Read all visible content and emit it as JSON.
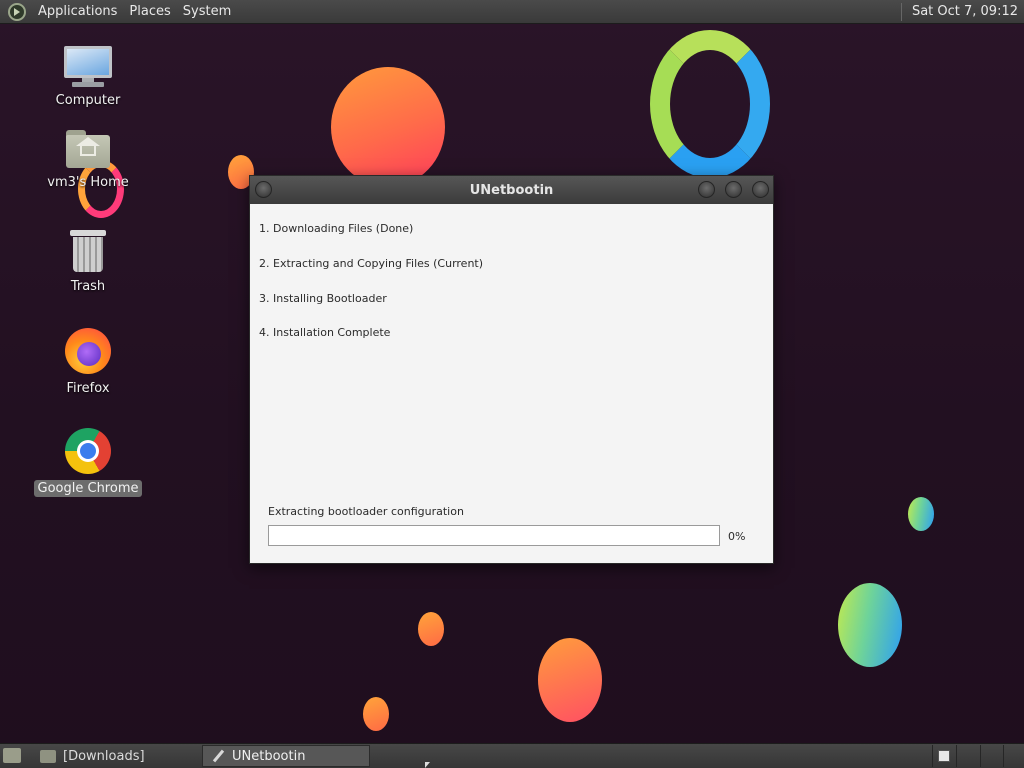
{
  "top_panel": {
    "menus": [
      "Applications",
      "Places",
      "System"
    ],
    "clock": "Sat Oct  7, 09:12"
  },
  "desktop": {
    "icons": [
      {
        "label": "Computer",
        "icon": "computer-icon"
      },
      {
        "label": "vm3's Home",
        "icon": "home-folder-icon"
      },
      {
        "label": "Trash",
        "icon": "trash-icon"
      },
      {
        "label": "Firefox",
        "icon": "firefox-icon"
      },
      {
        "label": "Google Chrome",
        "icon": "chrome-icon",
        "selected": true
      }
    ]
  },
  "window": {
    "title": "UNetbootin",
    "steps": [
      "1. Downloading Files (Done)",
      "2. Extracting and Copying Files (Current)",
      "3. Installing Bootloader",
      "4. Installation Complete"
    ],
    "status": "Extracting bootloader configuration",
    "progress": 0,
    "progress_label": "0%"
  },
  "taskbar": {
    "tasks": [
      "[Downloads]",
      "UNetbootin"
    ],
    "active_task": "UNetbootin",
    "workspaces": 4
  },
  "colors": {
    "desktop_bg": "#251324",
    "panel_bg": "#3f3f3f",
    "progress_fill": "#4a90d9"
  }
}
